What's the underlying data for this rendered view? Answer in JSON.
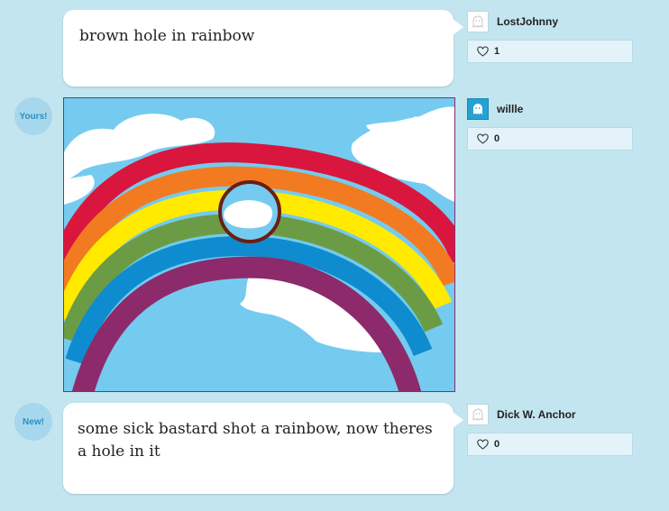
{
  "posts": [
    {
      "caption": "brown hole in rainbow",
      "user": "LostJohnny",
      "likes": "1",
      "avatar_icon": "ghost-icon",
      "avatar_color": "#ffffff"
    },
    {
      "badge": "Yours!",
      "user": "willle",
      "likes": "0",
      "avatar_icon": "ghost-icon",
      "avatar_color": "#25a2d3",
      "drawing": "rainbow with brown circle hole"
    },
    {
      "badge": "New!",
      "caption": "some sick bastard shot a rainbow, now theres a hole in it",
      "user": "Dick W. Anchor",
      "likes": "0",
      "avatar_icon": "ghost-icon",
      "avatar_color": "#ffffff"
    }
  ],
  "icons": {
    "like": "heart-outline-icon"
  },
  "colors": {
    "page_background": "#c3e5ef",
    "badge_background": "#a7d7ec",
    "badge_text": "#2a8fc4",
    "rainbow": [
      "#d9163d",
      "#f27b21",
      "#ffea00",
      "#6b9c45",
      "#0f8ccf",
      "#8d2a6b"
    ],
    "hole_ring": "#6b1e14",
    "sky": "#74cbef"
  }
}
